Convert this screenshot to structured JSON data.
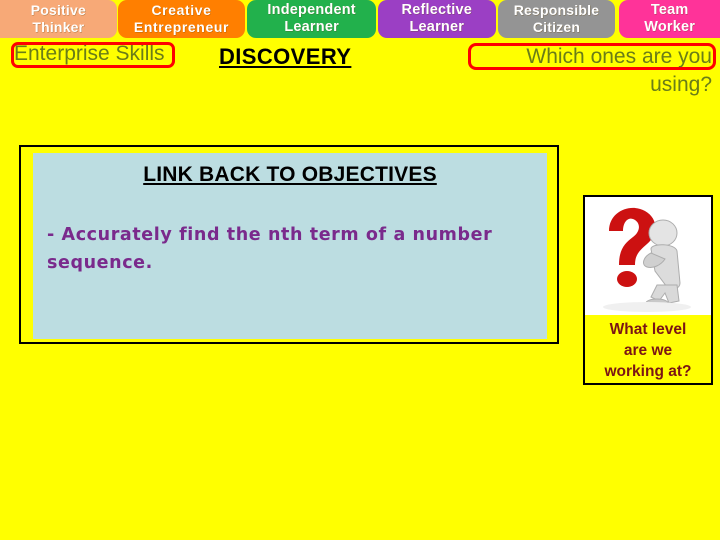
{
  "skill_tabs": [
    {
      "line1": "Positive",
      "line2": "Thinker",
      "color": "#F7A977",
      "name": "positive-thinker"
    },
    {
      "line1": "Creative",
      "line2": "Entrepreneur",
      "color": "#FF7F00",
      "name": "creative-entrepreneur"
    },
    {
      "line1": "Independent",
      "line2": "Learner",
      "color": "#22B14C",
      "name": "independent-learner"
    },
    {
      "line1": "Reflective",
      "line2": "Learner",
      "color": "#9B3FC4",
      "name": "reflective-learner"
    },
    {
      "line1": "Responsible",
      "line2": "Citizen",
      "color": "#949494",
      "name": "responsible-citizen"
    },
    {
      "line1": "Team",
      "line2": "Worker",
      "color": "#FF3399",
      "name": "team-worker"
    }
  ],
  "header": {
    "enterprise_skills": "Enterprise Skills",
    "discovery": "DISCOVERY",
    "which_ones_line1": "Which ones are you",
    "which_ones_line2": "using?",
    "highlight_color": "#FF0000",
    "olive_text_color": "#6A7D18"
  },
  "objectives": {
    "title": "LINK BACK TO OBJECTIVES",
    "body": "- Accurately find the nth term of a number sequence.",
    "panel_fill": "#BCDDE1",
    "text_color": "#7A2A8C"
  },
  "question_card": {
    "image_alt": "question-mark-thinker-figure",
    "caption_line1": "What level",
    "caption_line2": "are we",
    "caption_line3": "working at?",
    "caption_color": "#7B1515",
    "question_mark_color": "#CC1111"
  },
  "background_color": "#FFFF00"
}
